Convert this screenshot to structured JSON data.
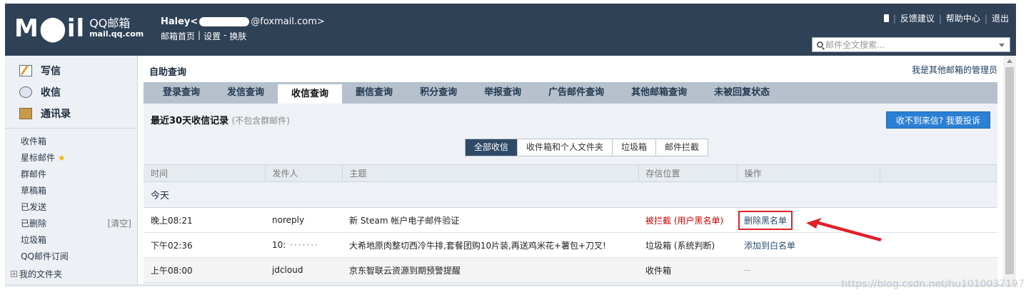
{
  "header": {
    "logo_mail": "M⬤il",
    "logo_qq": "QQ邮箱",
    "logo_url": "mail.qq.com",
    "user_name_prefix": "Haley<",
    "user_email_domain": "@foxmail.com>",
    "links": [
      "邮箱首页",
      "|",
      "设置",
      "-",
      "换肤"
    ],
    "top_links": [
      "反馈建议",
      "帮助中心",
      "退出"
    ],
    "search_placeholder": "邮件全文搜索..."
  },
  "sidebar": {
    "main": [
      {
        "label": "写信",
        "icon": "write-icon"
      },
      {
        "label": "收信",
        "icon": "inbox-icon"
      },
      {
        "label": "通讯录",
        "icon": "contacts-icon"
      }
    ],
    "folders": [
      "收件箱",
      "星标邮件",
      "群邮件",
      "草稿箱",
      "已发送",
      "已删除",
      "垃圾箱",
      "QQ邮件订阅"
    ],
    "clear_label": "[清空]",
    "my_folders": "我的文件夹"
  },
  "main": {
    "title": "自助查询",
    "admin_link": "我是其他邮箱的管理员",
    "tabs": [
      "登录查询",
      "发信查询",
      "收信查询",
      "删信查询",
      "积分查询",
      "举报查询",
      "广告邮件查询",
      "其他邮箱查询",
      "未被回复状态"
    ],
    "recent_title": "最近30天收信记录",
    "recent_note": "(不包含群邮件)",
    "complain_button": "收不到来信? 我要投诉",
    "filters": [
      "全部收信",
      "收件箱和个人文件夹",
      "垃圾箱",
      "邮件拦截"
    ],
    "columns": [
      "时间",
      "发件人",
      "主题",
      "存信位置",
      "操作"
    ],
    "group_label": "今天",
    "rows": [
      {
        "time": "晚上08:21",
        "sender": "noreply",
        "subject": "新 Steam 帐户电子邮件验证",
        "location": "被拦截 (用户黑名单)",
        "action": "删除黑名单"
      },
      {
        "time": "下午02:36",
        "sender": "10:",
        "subject": "大希地原肉整切西冷牛排,套餐团购10片装,再送鸡米花+薯包+刀叉!",
        "location": "垃圾箱 (系统判断)",
        "action": "添加到白名单"
      },
      {
        "time": "上午08:00",
        "sender": "jdcloud",
        "subject": "京东智联云资源到期预警提醒",
        "location": "收件箱",
        "action": "--"
      }
    ]
  },
  "watermark": "https://blog.csdn.net/hu1010037197",
  "colors": {
    "header_bg": "#2f4156",
    "accent_blue": "#2b7fd4",
    "highlight_red": "#e0202a"
  }
}
